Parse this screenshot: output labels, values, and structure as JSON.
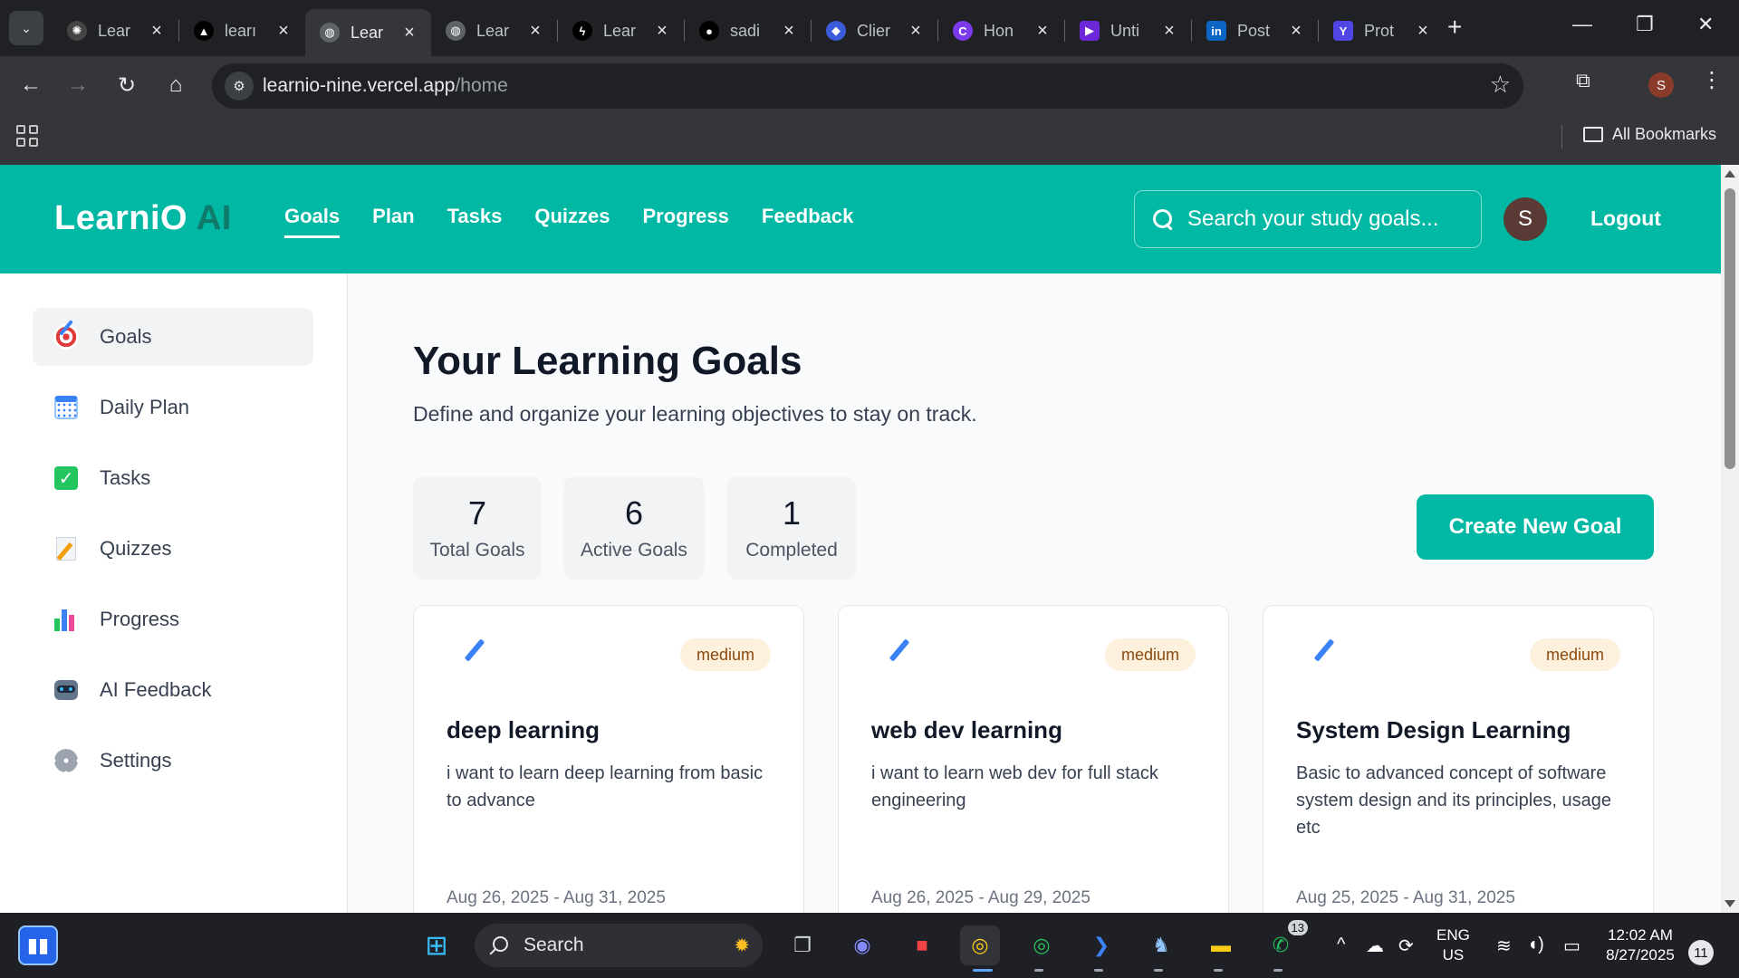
{
  "browser": {
    "tabs": [
      {
        "label": "Lear",
        "icon": "openai-icon",
        "color": "#444"
      },
      {
        "label": "learı",
        "icon": "vercel-icon",
        "color": "#000"
      },
      {
        "label": "Lear",
        "icon": "globe-icon",
        "color": "#5f6368",
        "active": true
      },
      {
        "label": "Lear",
        "icon": "globe-icon",
        "color": "#5f6368"
      },
      {
        "label": "Lear",
        "icon": "bolt-icon",
        "color": "#000"
      },
      {
        "label": "sadi",
        "icon": "github-icon",
        "color": "#000"
      },
      {
        "label": "Clier",
        "icon": "shield-icon",
        "color": "#3b5bdb"
      },
      {
        "label": "Hon",
        "icon": "canva-icon",
        "color": "#7c3aed"
      },
      {
        "label": "Unti",
        "icon": "video-icon",
        "color": "#6d28d9"
      },
      {
        "label": "Post",
        "icon": "linkedin-icon",
        "color": "#0a66c2"
      },
      {
        "label": "Prot",
        "icon": "app-icon",
        "color": "#4f46e5"
      }
    ],
    "url_domain": "learnio-nine.vercel.app",
    "url_path": "/home",
    "profile_initial": "S",
    "bookmarks_label": "All Bookmarks"
  },
  "header": {
    "logo_main": "LearniO",
    "logo_ai": "AI",
    "nav": [
      {
        "label": "Goals",
        "active": true
      },
      {
        "label": "Plan"
      },
      {
        "label": "Tasks"
      },
      {
        "label": "Quizzes"
      },
      {
        "label": "Progress"
      },
      {
        "label": "Feedback"
      }
    ],
    "search_placeholder": "Search your study goals...",
    "avatar_initial": "S",
    "logout_label": "Logout"
  },
  "sidebar": {
    "items": [
      {
        "label": "Goals",
        "icon": "target-icon",
        "active": true
      },
      {
        "label": "Daily Plan",
        "icon": "calendar-icon"
      },
      {
        "label": "Tasks",
        "icon": "checkbox-icon"
      },
      {
        "label": "Quizzes",
        "icon": "memo-icon"
      },
      {
        "label": "Progress",
        "icon": "bar-chart-icon"
      },
      {
        "label": "AI Feedback",
        "icon": "robot-icon"
      },
      {
        "label": "Settings",
        "icon": "gear-icon"
      }
    ]
  },
  "main": {
    "title": "Your Learning Goals",
    "subtitle": "Define and organize your learning objectives to stay on track.",
    "stats": [
      {
        "value": "7",
        "label": "Total Goals"
      },
      {
        "value": "6",
        "label": "Active Goals"
      },
      {
        "value": "1",
        "label": "Completed"
      }
    ],
    "create_label": "Create New Goal",
    "goals": [
      {
        "title": "deep learning",
        "priority": "medium",
        "description": "i want to learn deep learning from basic to advance",
        "dates": "Aug 26, 2025 - Aug 31, 2025"
      },
      {
        "title": "web dev learning",
        "priority": "medium",
        "description": "i want to learn web dev for full stack engineering",
        "dates": "Aug 26, 2025 - Aug 29, 2025"
      },
      {
        "title": "System Design Learning",
        "priority": "medium",
        "description": "Basic to advanced concept of software system design and its principles, usage etc",
        "dates": "Aug 25, 2025 - Aug 31, 2025"
      }
    ]
  },
  "taskbar": {
    "search_label": "Search",
    "whatsapp_badge": "13",
    "lang_top": "ENG",
    "lang_bottom": "US",
    "time": "12:02 AM",
    "date": "8/27/2025",
    "notification_count": "11"
  },
  "colors": {
    "brand": "#00b8a3",
    "brand_dark": "#0f7a6a",
    "badge_bg": "#fdf0dc",
    "badge_text": "#8a4a0f"
  }
}
